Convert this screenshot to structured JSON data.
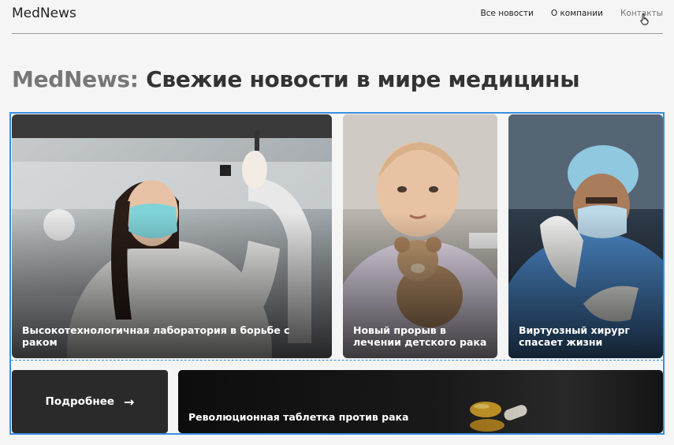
{
  "header": {
    "logo": "MedNews",
    "nav": [
      "Все новости",
      "О компании",
      "Контакты"
    ]
  },
  "headline": {
    "brand": "MedNews:",
    "rest": " Свежие новости в мире медицины"
  },
  "cards": [
    {
      "title": "Высокотехнологичная лаборатория в борьбе с раком"
    },
    {
      "title": "Новый прорыв в лечении детского рака"
    },
    {
      "title": "Виртуозный хирург спасает жизни"
    },
    {
      "title": "Революционная таблетка против рака"
    }
  ],
  "more_button": {
    "label": "Подробнее",
    "arrow": "→"
  },
  "colors": {
    "accent_outline": "#3a8ee0",
    "dark_button": "#2a2a2a"
  }
}
